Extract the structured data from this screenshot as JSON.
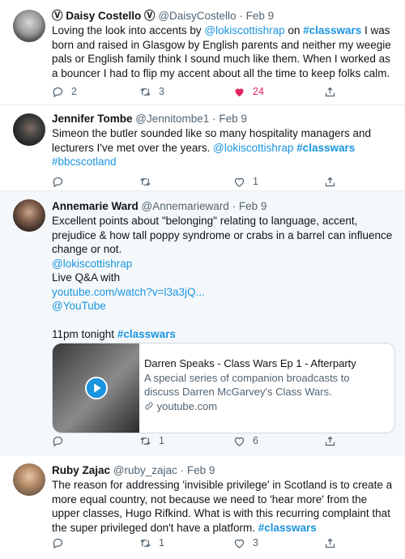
{
  "tweets": [
    {
      "name": "Ⓥ Daisy Costello Ⓥ",
      "handle": "@DaisyCostello",
      "sep": "·",
      "date": "Feb 9",
      "text": {
        "t1": "Loving the look into accents by ",
        "m1": "@lokiscottishrap",
        "t2": " on ",
        "h1": "#classwars",
        "t3": " I was born and raised in Glasgow by English parents and neither my weegie pals or English family think I sound much like them. When I worked as a bouncer I had to flip my accent about all the time to keep folks calm."
      },
      "replies": "2",
      "retweets": "3",
      "likes": "24"
    },
    {
      "name": "Jennifer Tombe",
      "handle": "@Jennitombe1",
      "sep": "·",
      "date": "Feb 9",
      "text": {
        "t1": "Simeon the butler sounded like so many hospitality managers and lecturers I've met over the years. ",
        "m1": "@lokiscottishrap",
        "h1": "#classwars",
        "h2": "#bbcscotland"
      },
      "likes": "1"
    },
    {
      "name": "Annemarie Ward",
      "handle": "@Annemarieward",
      "sep": "·",
      "date": "Feb 9",
      "text": {
        "t1": "Excellent points about \"belonging\" relating to language, accent, prejudice & how tall poppy syndrome or crabs in a barrel can influence change or not.",
        "m1": "@lokiscottishrap",
        "t2": " Live Q&A with",
        "l1": " youtube.com/watch?v=l3a3jQ...",
        "m2": "@YouTube",
        "t3": "11pm tonight ",
        "h1": "#classwars"
      },
      "card": {
        "title": "Darren Speaks - Class Wars Ep 1 - Afterparty",
        "desc": "A special series of companion broadcasts to discuss Darren McGarvey's Class Wars.",
        "domain": "youtube.com"
      },
      "retweets": "1",
      "likes": "6"
    },
    {
      "name": "Ruby Zajac",
      "handle": "@ruby_zajac",
      "sep": "·",
      "date": "Feb 9",
      "text": {
        "t1": "The reason for addressing 'invisible privilege' in Scotland is  to create a more equal country, not because we need to 'hear more' from the upper classes, Hugo Rifkind. What is with this recurring complaint that the super privileged don't have a platform.  ",
        "h1": "#classwars"
      },
      "retweets": "1",
      "likes": "3"
    }
  ],
  "colors": {
    "link": "#1b95e0",
    "like": "#e0245e",
    "meta": "#536471",
    "highlight_bg": "#f5f8fa"
  }
}
